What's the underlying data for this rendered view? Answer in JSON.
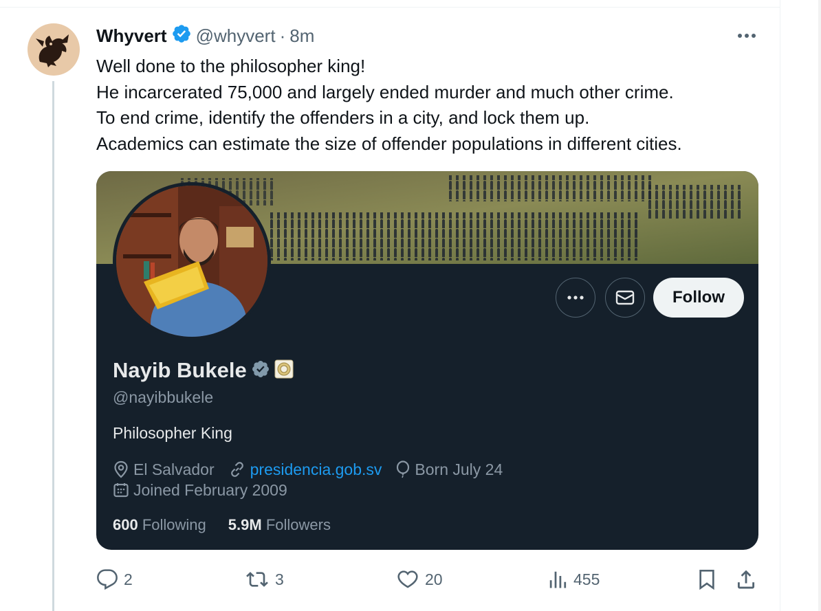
{
  "tweet": {
    "display_name": "Whyvert",
    "handle": "@whyvert",
    "separator": "·",
    "time": "8m",
    "lines": [
      "Well done to the philosopher king!",
      "He incarcerated 75,000 and largely ended murder and much other crime.",
      "To end crime, identify the offenders in a city, and lock them up.",
      "Academics can estimate the size of offender populations in different cities."
    ]
  },
  "profile_card": {
    "name": "Nayib Bukele",
    "handle": "@nayibbukele",
    "bio": "Philosopher King",
    "location": "El Salvador",
    "website": "presidencia.gob.sv",
    "birthday": "Born July 24",
    "joined": "Joined February 2009",
    "following_count": "600",
    "following_label": "Following",
    "followers_count": "5.9M",
    "followers_label": "Followers",
    "follow_label": "Follow"
  },
  "actions": {
    "replies": "2",
    "reposts": "3",
    "likes": "20",
    "views": "455"
  },
  "colors": {
    "accent": "#1d9bf0",
    "card_bg": "#15202b",
    "verified_blue": "#1d9bf0",
    "verified_gray": "#829aab"
  }
}
